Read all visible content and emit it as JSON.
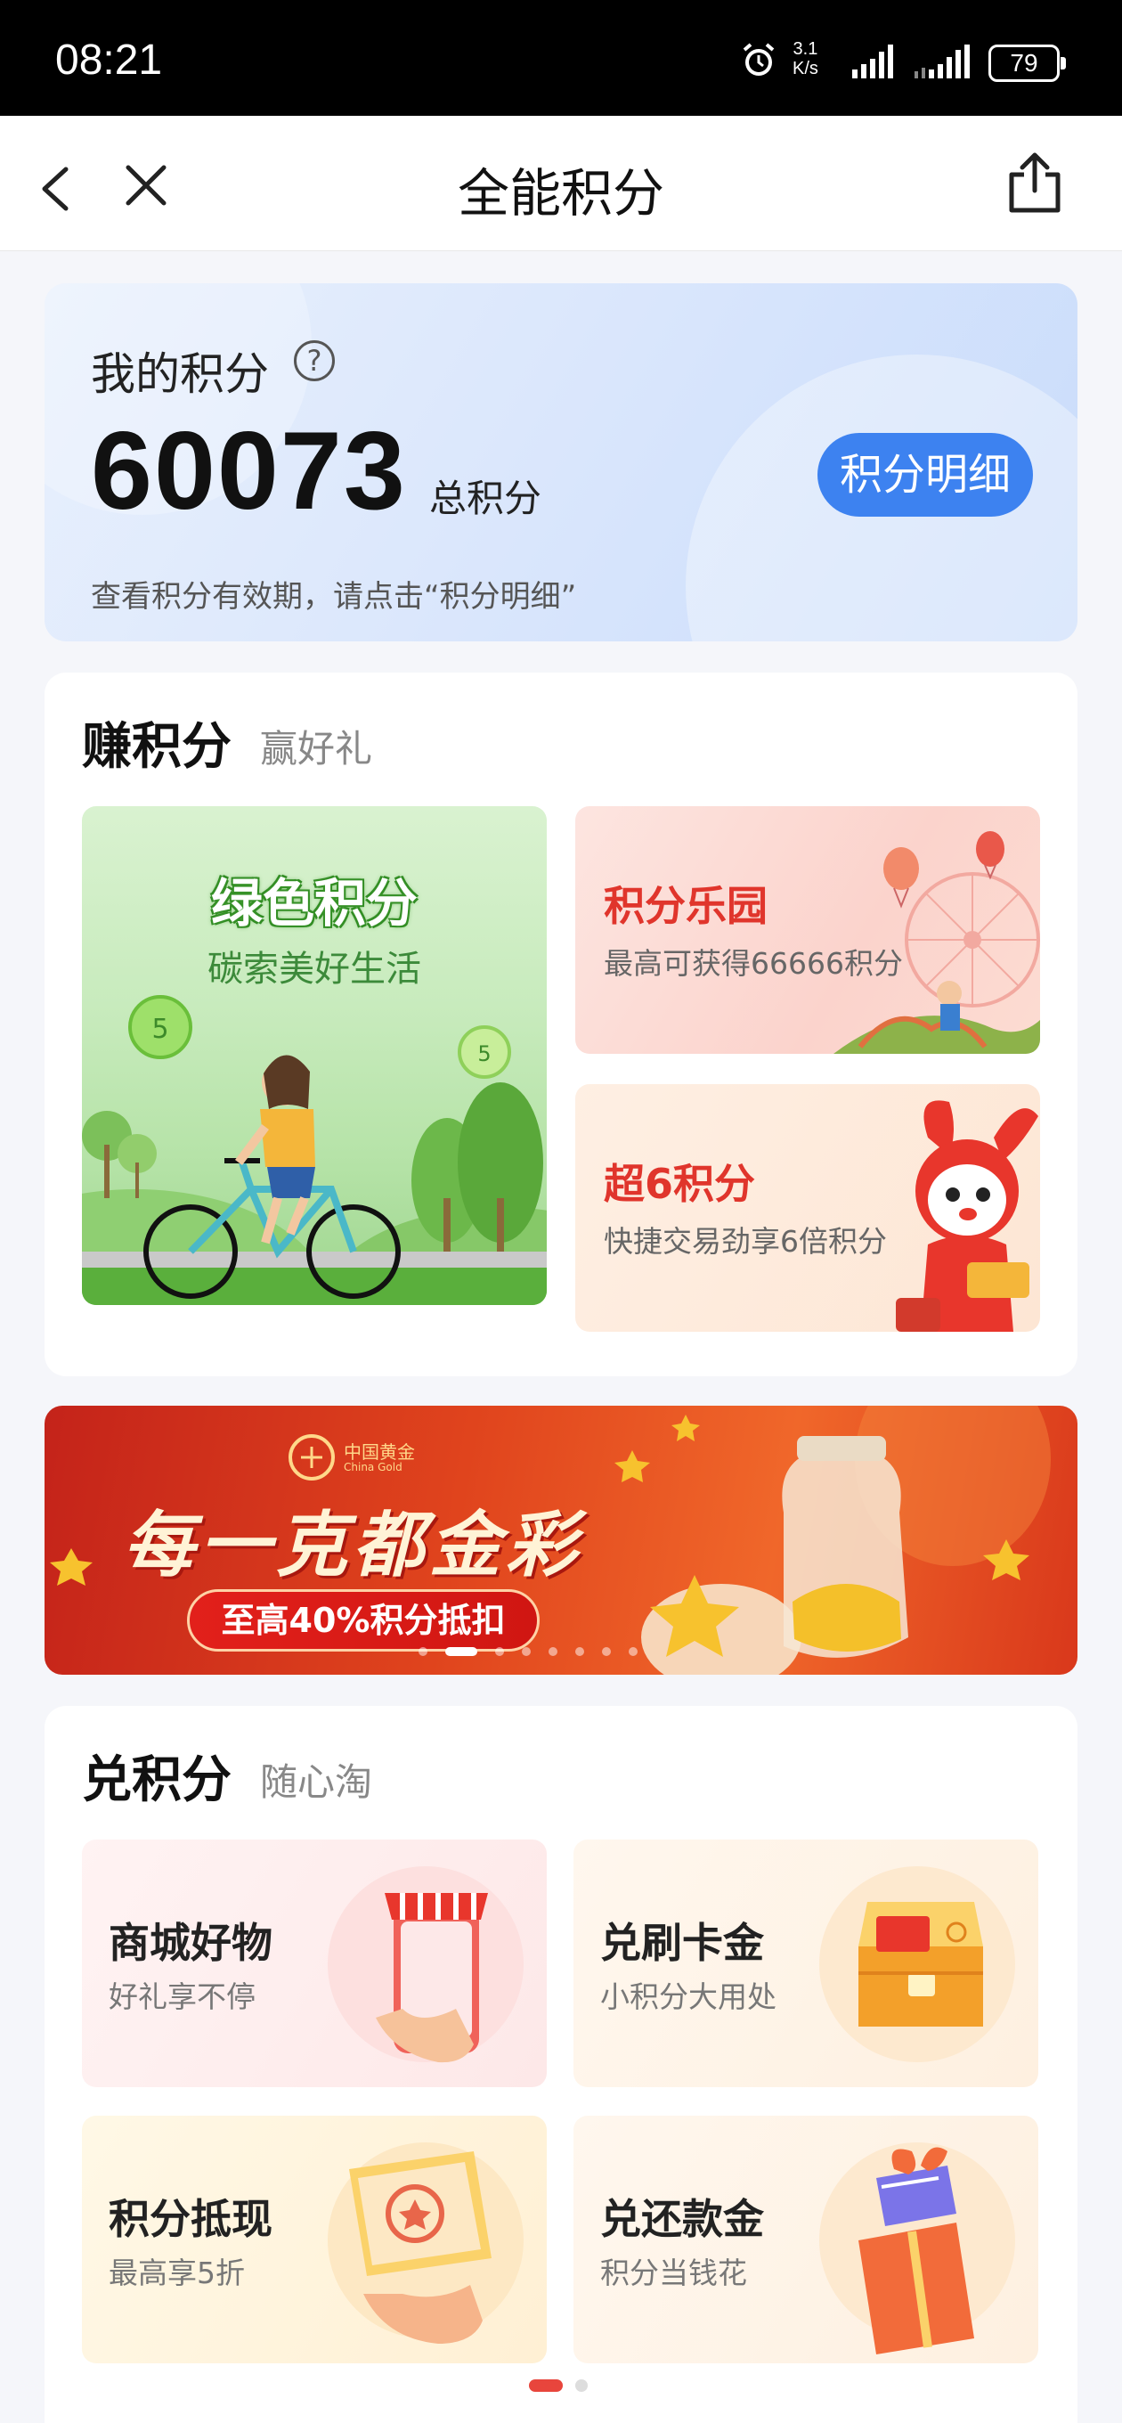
{
  "status_bar": {
    "time": "08:21",
    "net_speed_value": "3.1",
    "net_speed_unit": "K/s",
    "battery": "79"
  },
  "nav": {
    "title": "全能积分",
    "icons": [
      "back-arrow-icon",
      "close-icon",
      "share-icon"
    ]
  },
  "points": {
    "label": "我的积分",
    "value": "60073",
    "unit": "总积分",
    "detail_button": "积分明细",
    "hint": "查看积分有效期，请点击“积分明细”"
  },
  "earn": {
    "title": "赚积分",
    "subtitle": "赢好礼",
    "green": {
      "title": "绿色积分",
      "subtitle": "碳索美好生活",
      "coin1": "5",
      "coin2": "5"
    },
    "park": {
      "title": "积分乐园",
      "subtitle": "最高可获得66666积分"
    },
    "six": {
      "title": "超6积分",
      "subtitle": "快捷交易劲享6倍积分"
    }
  },
  "banner": {
    "logo_cn": "中国黄金",
    "logo_en": "China Gold",
    "slogan": "每一克都金彩",
    "pill": "至高40%积分抵扣",
    "slide_count": 8,
    "active_slide": 1
  },
  "exchange": {
    "title": "兑积分",
    "subtitle": "随心淘",
    "items": [
      {
        "title": "商城好物",
        "subtitle": "好礼享不停",
        "icon": "shop-phone-icon"
      },
      {
        "title": "兑刷卡金",
        "subtitle": "小积分大用处",
        "icon": "treasure-chest-icon"
      },
      {
        "title": "积分抵现",
        "subtitle": "最高享5折",
        "icon": "coupon-hand-icon"
      },
      {
        "title": "兑还款金",
        "subtitle": "积分当钱花",
        "icon": "gift-box-icon"
      }
    ],
    "page_count": 2,
    "active_page": 1
  },
  "colors": {
    "accent_blue": "#3d82f0",
    "accent_red": "#e0352c",
    "green_title": "#3c8a3a"
  }
}
